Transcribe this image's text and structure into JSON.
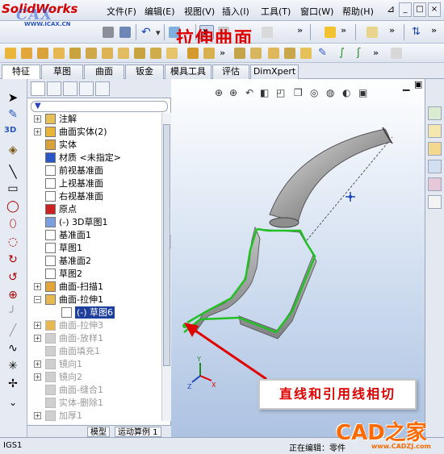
{
  "app": {
    "logo_text": "SolidWorks",
    "watermark_logo": "CAX",
    "watermark_url": "WWW.ICAX.CN"
  },
  "menu": [
    "文件(F)",
    "编辑(E)",
    "视图(V)",
    "插入(I)",
    "工具(T)",
    "窗口(W)",
    "帮助(H)"
  ],
  "window_buttons": [
    "_",
    "□",
    "×"
  ],
  "annotation_title": "拉伸曲面",
  "tabs": [
    {
      "label": "特征",
      "active": true
    },
    {
      "label": "草图",
      "active": false
    },
    {
      "label": "曲面",
      "active": false
    },
    {
      "label": "钣金",
      "active": false
    },
    {
      "label": "模具工具",
      "active": false
    },
    {
      "label": "评估",
      "active": false
    },
    {
      "label": "DimXpert",
      "active": false
    }
  ],
  "tree": [
    {
      "label": "注解",
      "expand": "+",
      "icon": "annotations-icon",
      "disabled": false
    },
    {
      "label": "曲面实体(2)",
      "expand": "+",
      "icon": "surface-bodies-icon",
      "disabled": false
    },
    {
      "label": "实体",
      "expand": "",
      "icon": "solid-bodies-icon",
      "disabled": false
    },
    {
      "label": "材质 <未指定>",
      "expand": "",
      "icon": "material-icon",
      "disabled": false
    },
    {
      "label": "前视基准面",
      "expand": "",
      "icon": "plane-icon",
      "disabled": false
    },
    {
      "label": "上视基准面",
      "expand": "",
      "icon": "plane-icon",
      "disabled": false
    },
    {
      "label": "右视基准面",
      "expand": "",
      "icon": "plane-icon",
      "disabled": false
    },
    {
      "label": "原点",
      "expand": "",
      "icon": "origin-icon",
      "disabled": false
    },
    {
      "label": "(-) 3D草图1",
      "expand": "",
      "icon": "3d-sketch-icon",
      "disabled": false
    },
    {
      "label": "基准面1",
      "expand": "",
      "icon": "plane-icon",
      "disabled": false
    },
    {
      "label": "草图1",
      "expand": "",
      "icon": "sketch-icon",
      "disabled": false
    },
    {
      "label": "基准面2",
      "expand": "",
      "icon": "plane-icon",
      "disabled": false
    },
    {
      "label": "草图2",
      "expand": "",
      "icon": "sketch-icon",
      "disabled": false
    },
    {
      "label": "曲面-扫描1",
      "expand": "+",
      "icon": "sweep-surface-icon",
      "disabled": false
    },
    {
      "label": "曲面-拉伸1",
      "expand": "-",
      "icon": "extrude-surface-icon",
      "disabled": false
    },
    {
      "label": "(-) 草图6",
      "expand": "",
      "icon": "sketch-icon",
      "disabled": false,
      "selected": true,
      "child": true
    },
    {
      "label": "曲面-拉伸3",
      "expand": "+",
      "icon": "extrude-surface-icon",
      "disabled": true
    },
    {
      "label": "曲面-放样1",
      "expand": "+",
      "icon": "loft-surface-icon",
      "disabled": true
    },
    {
      "label": "曲面填充1",
      "expand": "",
      "icon": "fill-surface-icon",
      "disabled": true
    },
    {
      "label": "镜向1",
      "expand": "+",
      "icon": "mirror-icon",
      "disabled": true
    },
    {
      "label": "镜向2",
      "expand": "+",
      "icon": "mirror-icon",
      "disabled": true
    },
    {
      "label": "曲面-缝合1",
      "expand": "",
      "icon": "knit-surface-icon",
      "disabled": true
    },
    {
      "label": "实体-删除1",
      "expand": "",
      "icon": "delete-body-icon",
      "disabled": true
    },
    {
      "label": "加厚1",
      "expand": "+",
      "icon": "thicken-icon",
      "disabled": true
    }
  ],
  "bottom_tabs": [
    "模型",
    "运动算例 1"
  ],
  "callout_text": "直线和引用线相切",
  "status": {
    "left": "IGS1",
    "editing": "正在编辑：零件"
  },
  "watermark": {
    "brand": "CAD之家",
    "url": "www.CADZJ.com"
  },
  "colors": {
    "accent_red": "#e00000",
    "selection_blue": "#1f3f9e",
    "sketch_green": "#22c022",
    "watermark_orange": "#ff6a00"
  }
}
